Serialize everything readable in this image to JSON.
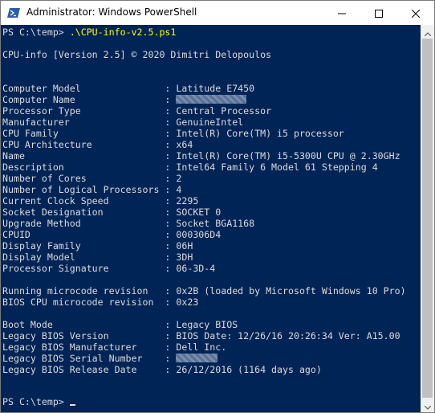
{
  "window": {
    "title": "Administrator: Windows PowerShell",
    "minimize_icon": "minimize-icon",
    "maximize_icon": "maximize-icon",
    "close_icon": "close-icon",
    "app_icon": "powershell-icon"
  },
  "console": {
    "background": "#012456",
    "text_color": "#dcdcdc",
    "command_color": "#ffff00",
    "prompt1": "PS C:\\temp> ",
    "command": ".\\CPU-info-v2.5.ps1",
    "header": "CPU-info [Version 2.5] © 2020 Dimitri Delopoulos",
    "cpu_rows": [
      {
        "label": "Computer Model               : ",
        "value": "Latitude E7450"
      },
      {
        "label": "Computer Name                : ",
        "value": ""
      },
      {
        "label": "Processor Type               : ",
        "value": "Central Processor"
      },
      {
        "label": "Manufacturer                 : ",
        "value": "GenuineIntel"
      },
      {
        "label": "CPU Family                   : ",
        "value": "Intel(R) Core(TM) i5 processor"
      },
      {
        "label": "CPU Architecture             : ",
        "value": "x64"
      },
      {
        "label": "Name                         : ",
        "value": "Intel(R) Core(TM) i5-5300U CPU @ 2.30GHz"
      },
      {
        "label": "Description                  : ",
        "value": "Intel64 Family 6 Model 61 Stepping 4"
      },
      {
        "label": "Number of Cores              : ",
        "value": "2"
      },
      {
        "label": "Number of Logical Processors : ",
        "value": "4"
      },
      {
        "label": "Current Clock Speed          : ",
        "value": "2295"
      },
      {
        "label": "Socket Designation           : ",
        "value": "SOCKET 0"
      },
      {
        "label": "Upgrade Method               : ",
        "value": "Socket BGA1168"
      },
      {
        "label": "CPUID                        : ",
        "value": "000306D4"
      },
      {
        "label": "Display Family               : ",
        "value": "06H"
      },
      {
        "label": "Display Model                : ",
        "value": "3DH"
      },
      {
        "label": "Processor Signature          : ",
        "value": "06-3D-4"
      }
    ],
    "microcode_rows": [
      {
        "label": "Running microcode revision   : ",
        "value": "0x2B (loaded by Microsoft Windows 10 Pro)"
      },
      {
        "label": "BIOS CPU microcode revision  : ",
        "value": "0x23"
      }
    ],
    "bios_rows": [
      {
        "label": "Boot Mode                    : ",
        "value": "Legacy BIOS"
      },
      {
        "label": "Legacy BIOS Version          : ",
        "value": "BIOS Date: 12/26/16 20:26:34 Ver: A15.00"
      },
      {
        "label": "Legacy BIOS Manufacturer     : ",
        "value": "Dell Inc."
      },
      {
        "label": "Legacy BIOS Serial Number    : ",
        "value": ""
      },
      {
        "label": "Legacy BIOS Release Date     : ",
        "value": "26/12/2016 (1164 days ago)"
      }
    ],
    "prompt2": "PS C:\\temp> "
  }
}
